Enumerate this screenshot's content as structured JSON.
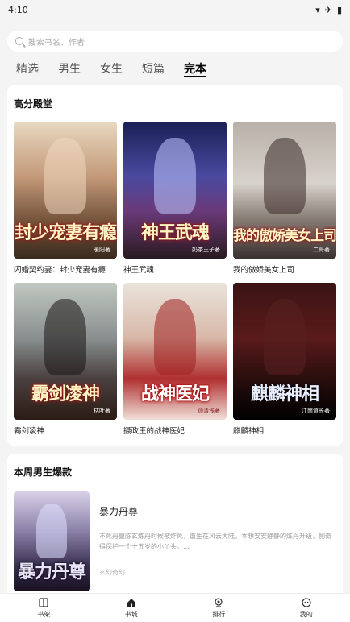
{
  "status": {
    "time": "4:10"
  },
  "search": {
    "placeholder": "搜索书名、作者"
  },
  "tabs": [
    {
      "label": "精选"
    },
    {
      "label": "男生"
    },
    {
      "label": "女生"
    },
    {
      "label": "短篇"
    },
    {
      "label": "完本",
      "active": true
    }
  ],
  "high_score": {
    "title": "高分殿堂",
    "books": [
      {
        "title": "闪婚契约妻：封少宠妻有瘾",
        "cover_text": "封少宠妻有瘾",
        "cover_author": "暖阳著"
      },
      {
        "title": "神王武魂",
        "cover_text": "神王武魂",
        "cover_author": "奶茶王子著"
      },
      {
        "title": "我的傲娇美女上司",
        "cover_text": "我的傲娇美女上司",
        "cover_author": "二哥著"
      },
      {
        "title": "霸剑凌神",
        "cover_text": "霸剑凌神",
        "cover_author": "枯叶著"
      },
      {
        "title": "摄政王的战神医妃",
        "cover_text": "战神医妃",
        "cover_author": "顾清浅著"
      },
      {
        "title": "麒麟神相",
        "cover_text": "麒麟神相",
        "cover_author": "江南道长著"
      }
    ]
  },
  "weekly": {
    "title": "本周男生爆款",
    "item": {
      "title": "暴力丹尊",
      "cover_text": "暴力丹尊",
      "desc": "不死丹皇陈玄炼丹时候被炸死，重生在风云大陆，本想安安静静的炼丹升级，侧奇得保护一个十五岁的小丫头。...",
      "genre": "玄幻奇幻"
    }
  },
  "nav": [
    {
      "label": "书架",
      "icon": "book-icon"
    },
    {
      "label": "书城",
      "icon": "home-icon",
      "active": true
    },
    {
      "label": "排行",
      "icon": "rank-icon"
    },
    {
      "label": "我的",
      "icon": "profile-icon"
    }
  ]
}
